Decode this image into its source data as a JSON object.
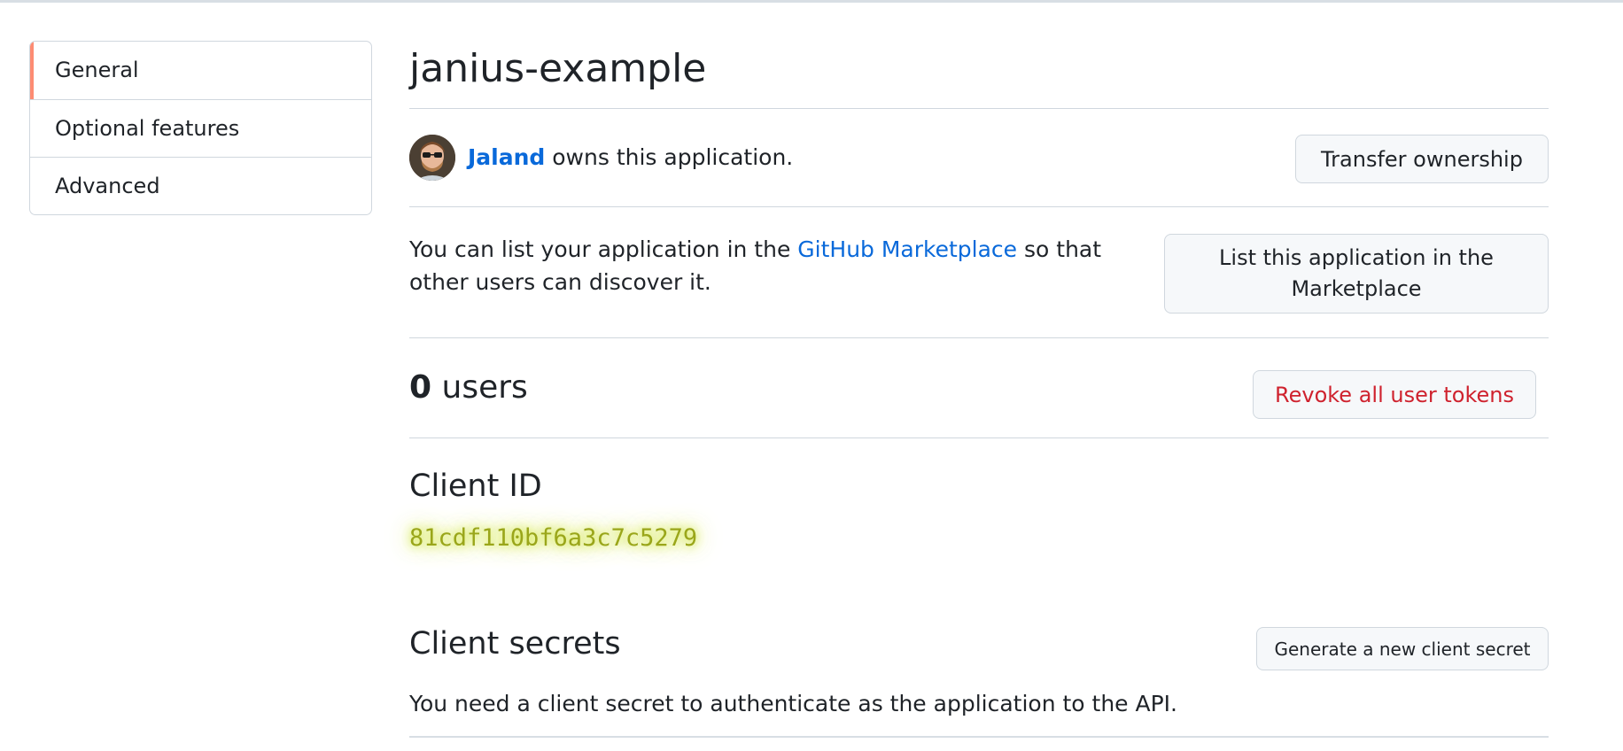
{
  "sidebar": {
    "items": [
      {
        "label": "General",
        "active": true
      },
      {
        "label": "Optional features",
        "active": false
      },
      {
        "label": "Advanced",
        "active": false
      }
    ]
  },
  "app": {
    "name": "janius-example"
  },
  "owner": {
    "username": "Jaland",
    "suffix": " owns this application.",
    "transfer_label": "Transfer ownership"
  },
  "marketplace": {
    "text_before": "You can list your application in the ",
    "link_label": "GitHub Marketplace",
    "text_after": " so that other users can discover it.",
    "button_label": "List this application in the Marketplace"
  },
  "users": {
    "count": "0",
    "label": " users",
    "revoke_label": "Revoke all user tokens"
  },
  "client_id": {
    "heading": "Client ID",
    "value": "81cdf110bf6a3c7c5279"
  },
  "client_secrets": {
    "heading": "Client secrets",
    "generate_label": "Generate a new client secret",
    "description": "You need a client secret to authenticate as the application to the API."
  },
  "colors": {
    "accent": "#fd8c73",
    "link": "#0969da",
    "danger": "#cf222e",
    "highlight": "#d4e61a"
  }
}
